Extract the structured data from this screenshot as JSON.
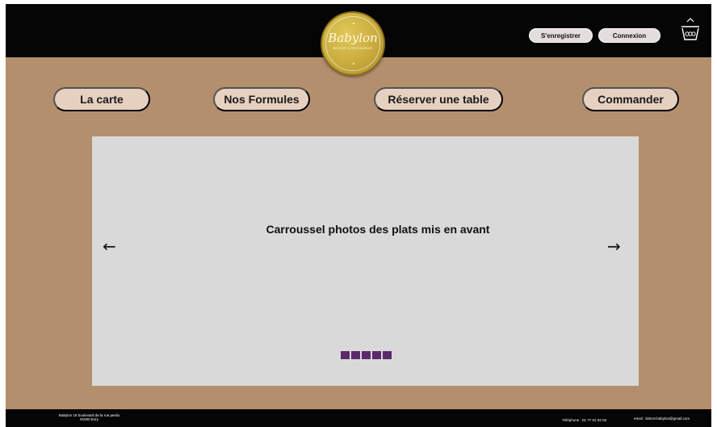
{
  "header": {
    "logo": {
      "name": "Babylon",
      "tagline": "BISTROT & RESTAURANT"
    },
    "register_label": "S'enregistrer",
    "login_label": "Connexion",
    "basket_icon": "basket-icon"
  },
  "nav": {
    "items": [
      {
        "label": "La carte"
      },
      {
        "label": "Nos Formules"
      },
      {
        "label": "Réserver une table"
      },
      {
        "label": "Commander"
      }
    ]
  },
  "carousel": {
    "text": "Carroussel photos des plats mis en avant",
    "prev_arrow": "←",
    "next_arrow": "→",
    "indicator_count": 5,
    "indicator_color": "#5b2a6b"
  },
  "footer": {
    "address_line1": "Babylon 15 boulevard de la rue perdu",
    "address_line2": "91000 Evry",
    "phone": "Téléphone : 01 77 01 02 03",
    "email": "email : bistrot-babylon@gmail.com"
  },
  "colors": {
    "background": "#b38f6e",
    "header": "#050505",
    "nav_button": "#e6d0c0",
    "carousel": "#d9d9d9",
    "logo_gold": "#c9ab3c"
  }
}
